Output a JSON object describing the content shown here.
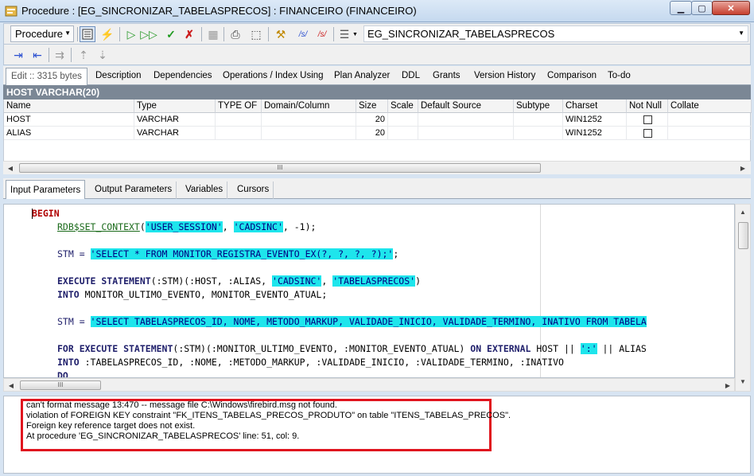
{
  "window": {
    "title": "Procedure : [EG_SINCRONIZAR_TABELASPRECOS] : FINANCEIRO (FINANCEIRO)",
    "buttons": {
      "minimize": "▁",
      "maximize": "▢",
      "close": "✕"
    }
  },
  "toolbar": {
    "object_type": "Procedure",
    "object_name": "EG_SINCRONIZAR_TABELASPRECOS",
    "icons": [
      "edit-mode-icon",
      "compile-icon",
      "run-icon",
      "step-run-icon",
      "commit-icon",
      "rollback-icon",
      "grid-icon",
      "print-icon",
      "dependencies-icon",
      "debug-icon",
      "sql-text-icon",
      "sql-text-red-icon",
      "param-list-icon"
    ]
  },
  "tabs": [
    {
      "label": "Edit :: 3315 bytes",
      "active": true
    },
    {
      "label": "Description"
    },
    {
      "label": "Dependencies"
    },
    {
      "label": "Operations / Index Using"
    },
    {
      "label": "Plan Analyzer"
    },
    {
      "label": "DDL"
    },
    {
      "label": "Grants"
    },
    {
      "label": "Version History"
    },
    {
      "label": "Comparison"
    },
    {
      "label": "To-do"
    }
  ],
  "grid": {
    "header": "HOST VARCHAR(20)",
    "columns": [
      "Name",
      "Type",
      "TYPE OF",
      "Domain/Column",
      "Size",
      "Scale",
      "Default Source",
      "Subtype",
      "Charset",
      "Not Null",
      "Collate"
    ],
    "rows": [
      {
        "name": "HOST",
        "type": "VARCHAR",
        "size": "20",
        "charset": "WIN1252",
        "not_null": false
      },
      {
        "name": "ALIAS",
        "type": "VARCHAR",
        "size": "20",
        "charset": "WIN1252",
        "not_null": false
      }
    ],
    "hscroll_grip": "III"
  },
  "param_tabs": [
    {
      "label": "Input Parameters",
      "active": true
    },
    {
      "label": "Output Parameters"
    },
    {
      "label": "Variables"
    },
    {
      "label": "Cursors"
    }
  ],
  "editor": {
    "hscroll_grip": "III",
    "lines": {
      "l1": "BEGIN",
      "l2_fn": "RDB$SET_CONTEXT",
      "l2_p1": "'USER_SESSION'",
      "l2_p2": "'CADSINC'",
      "l2_rest": ", -1);",
      "l3_a": "STM = ",
      "l3_str": "'SELECT * FROM MONITOR_REGISTRA_EVENTO_EX(?, ?, ?, ?);'",
      "l3_end": ";",
      "l4_kw": "EXECUTE STATEMENT",
      "l4_a": "(:STM)(:HOST, :ALIAS, ",
      "l4_s1": "'CADSINC'",
      "l4_s2": "'TABELASPRECOS'",
      "l4_end": ")",
      "l5_kw": "INTO",
      "l5_a": " MONITOR_ULTIMO_EVENTO, MONITOR_EVENTO_ATUAL;",
      "l6_a": "STM = ",
      "l6_str": "'SELECT TABELASPRECOS_ID, NOME, METODO_MARKUP, VALIDADE_INICIO, VALIDADE_TERMINO, INATIVO FROM TABELA",
      "l7_kw1": "FOR EXECUTE STATEMENT",
      "l7_a": "(:STM)(:MONITOR_ULTIMO_EVENTO, :MONITOR_EVENTO_ATUAL) ",
      "l7_kw2": "ON EXTERNAL",
      "l7_b": " HOST || ",
      "l7_s": "':'",
      "l7_c": " || ALIAS",
      "l8_kw": "INTO",
      "l8_a": " :TABELASPRECOS_ID, :NOME, :METODO_MARKUP, :VALIDADE_INICIO, :VALIDADE_TERMINO, :INATIVO",
      "l9_kw": "DO"
    }
  },
  "messages": [
    "can't format message 13:470 -- message file C:\\Windows\\firebird.msg not found.",
    "violation of FOREIGN KEY constraint \"FK_ITENS_TABELAS_PRECOS_PRODUTO\" on table \"ITENS_TABELAS_PRECOS\".",
    "Foreign key reference target does not exist.",
    "At procedure 'EG_SINCRONIZAR_TABELASPRECOS' line: 51, col: 9."
  ],
  "colors": {
    "highlight_border": "#e0141e",
    "string_bg": "#1ee5ec",
    "grid_header": "#7b8795"
  }
}
